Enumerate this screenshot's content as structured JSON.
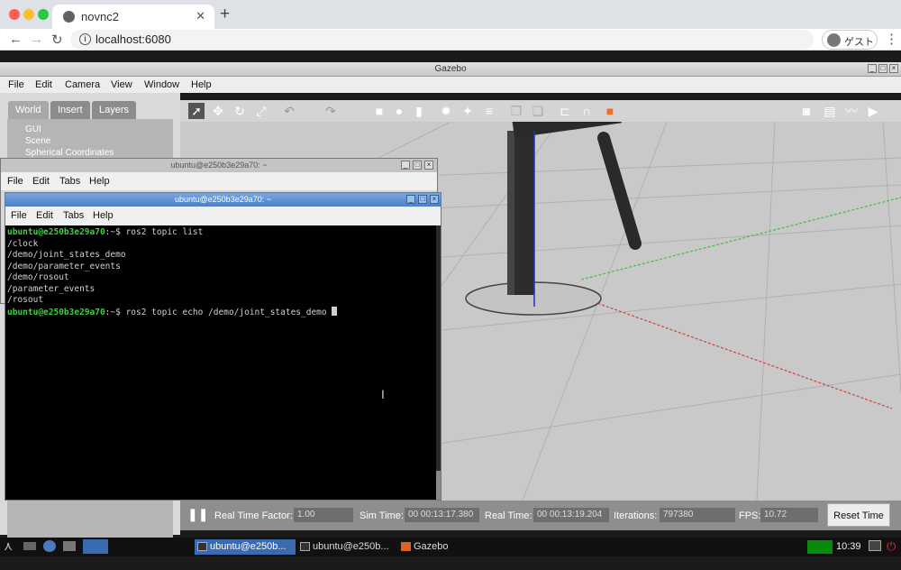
{
  "browser": {
    "tab_title": "novnc2",
    "tab_close": "✕",
    "new_tab": "+",
    "url": "localhost:6080",
    "guest_label": "ゲスト",
    "colors": {
      "red": "#ff5f57",
      "yellow": "#febc2e",
      "green": "#28c840"
    }
  },
  "gazebo": {
    "window_title": "Gazebo",
    "menu": [
      "File",
      "Edit",
      "Camera",
      "View",
      "Window",
      "Help"
    ],
    "left_tabs": [
      "World",
      "Insert",
      "Layers"
    ],
    "world_items": [
      "GUI",
      "Scene",
      "Spherical Coordinates"
    ],
    "toolbar_icons": [
      "select-icon",
      "translate-icon",
      "rotate-icon",
      "scale-icon",
      "undo-icon",
      "redo-icon",
      "box-icon",
      "sphere-icon",
      "cylinder-icon",
      "point-light-icon",
      "spot-light-icon",
      "directional-light-icon",
      "copy-icon",
      "paste-icon",
      "align-icon",
      "snap-icon",
      "change-view-icon",
      "screenshot-icon",
      "log-icon",
      "plot-icon",
      "record-icon"
    ],
    "bottom_bar": {
      "rtf_label": "Real Time Factor:",
      "rtf_value": "1.00",
      "sim_time_label": "Sim Time:",
      "sim_time_value": "00 00:13:17.380",
      "real_time_label": "Real Time:",
      "real_time_value": "00 00:13:19.204",
      "iterations_label": "Iterations:",
      "iterations_value": "797380",
      "fps_label": "FPS:",
      "fps_value": "10.72",
      "reset_label": "Reset Time"
    }
  },
  "terminal_back": {
    "title": "ubuntu@e250b3e29a70: ~",
    "menu": [
      "File",
      "Edit",
      "Tabs",
      "Help"
    ]
  },
  "terminal_front": {
    "title": "ubuntu@e250b3e29a70: ~",
    "menu": [
      "File",
      "Edit",
      "Tabs",
      "Help"
    ],
    "prompt": "ubuntu@e250b3e29a70",
    "lines": [
      {
        "prompt": true,
        "suffix": ":~$ ",
        "text": "ros2 topic list"
      },
      {
        "prompt": false,
        "text": "/clock"
      },
      {
        "prompt": false,
        "text": "/demo/joint_states_demo"
      },
      {
        "prompt": false,
        "text": "/demo/parameter_events"
      },
      {
        "prompt": false,
        "text": "/demo/rosout"
      },
      {
        "prompt": false,
        "text": "/parameter_events"
      },
      {
        "prompt": false,
        "text": "/rosout"
      },
      {
        "prompt": true,
        "suffix": ":~$ ",
        "text": "ros2 topic echo /demo/joint_states_demo "
      }
    ]
  },
  "taskbar": {
    "tasks": [
      "ubuntu@e250b...",
      "ubuntu@e250b...",
      "Gazebo"
    ],
    "clock": "10:39"
  }
}
